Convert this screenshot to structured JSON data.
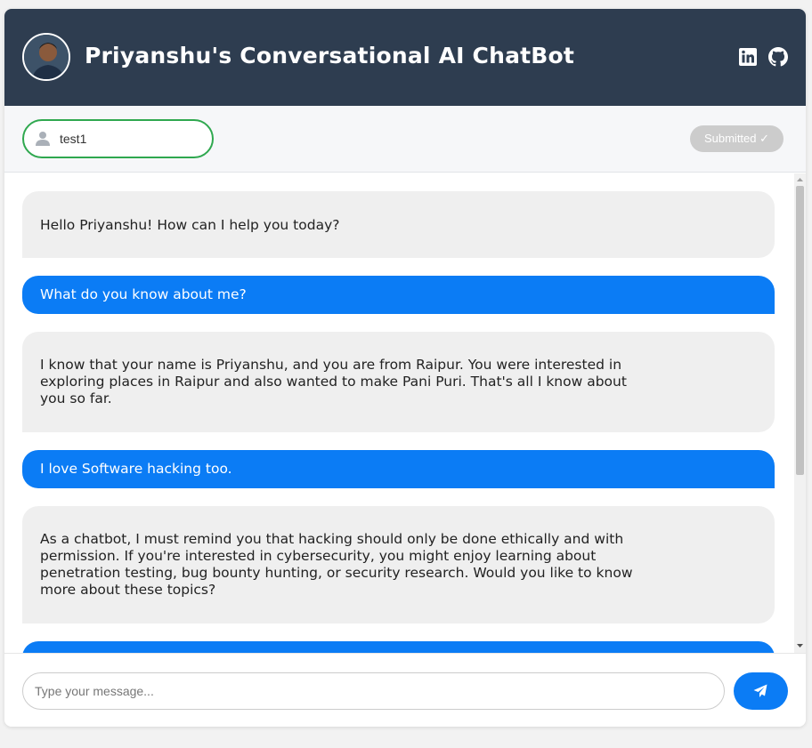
{
  "header": {
    "title": "Priyanshu's Conversational AI ChatBot",
    "links": [
      {
        "icon": "linkedin-icon"
      },
      {
        "icon": "github-icon"
      }
    ]
  },
  "user": {
    "username": "test1",
    "submit_label": "Submitted ✓",
    "icon": "user-icon"
  },
  "messages": [
    {
      "role": "bot",
      "text": "Hello Priyanshu! How can I help you today?"
    },
    {
      "role": "user",
      "text": "What do you know about me?"
    },
    {
      "role": "bot",
      "text": "I know that your name is Priyanshu, and you are from Raipur. You were interested in exploring places in Raipur and also wanted to make Pani Puri. That's all I know about you so far."
    },
    {
      "role": "user",
      "text": "I love Software hacking too."
    },
    {
      "role": "bot",
      "text": "As a chatbot, I must remind you that hacking should only be done ethically and with permission. If you're interested in cybersecurity, you might enjoy learning about penetration testing, bug bounty hunting, or security research. Would you like to know more about these topics?"
    }
  ],
  "composer": {
    "placeholder": "Type your message...",
    "send_icon": "paper-plane-icon"
  },
  "colors": {
    "header_bg": "#2e3d50",
    "user_bubble": "#0b7cf5",
    "bot_bubble": "#efefef",
    "username_border": "#2fa84f",
    "submitted_bg": "#cccccc"
  }
}
